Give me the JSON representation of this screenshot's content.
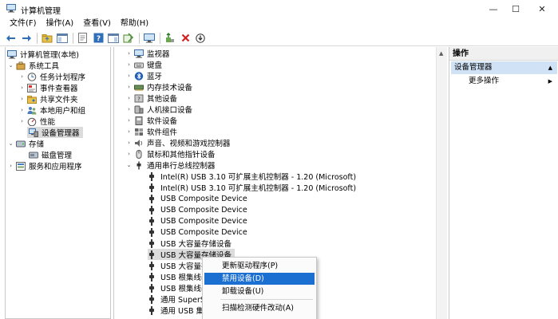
{
  "window": {
    "title": "计算机管理",
    "minimize": "—",
    "maximize": "☐",
    "close": "✕"
  },
  "menu": [
    "文件(F)",
    "操作(A)",
    "查看(V)",
    "帮助(H)"
  ],
  "left_tree": [
    {
      "label": "计算机管理(本地)",
      "expander": "",
      "icon": "computer-icon"
    },
    {
      "label": "系统工具",
      "expander": "⌄",
      "icon": "tools-icon"
    },
    {
      "label": "任务计划程序",
      "expander": "›",
      "icon": "clock-icon"
    },
    {
      "label": "事件查看器",
      "expander": "›",
      "icon": "event-viewer-icon"
    },
    {
      "label": "共享文件夹",
      "expander": "›",
      "icon": "shared-folder-icon"
    },
    {
      "label": "本地用户和组",
      "expander": "›",
      "icon": "users-icon"
    },
    {
      "label": "性能",
      "expander": "›",
      "icon": "performance-icon"
    },
    {
      "label": "设备管理器",
      "expander": "",
      "icon": "device-manager-icon"
    },
    {
      "label": "存储",
      "expander": "⌄",
      "icon": "storage-icon"
    },
    {
      "label": "磁盘管理",
      "expander": "",
      "icon": "disk-icon"
    },
    {
      "label": "服务和应用程序",
      "expander": "›",
      "icon": "services-icon"
    }
  ],
  "device_tree": [
    {
      "label": "监视器",
      "expander": "›",
      "icon": "monitor-icon",
      "child": false
    },
    {
      "label": "键盘",
      "expander": "›",
      "icon": "keyboard-icon",
      "child": false
    },
    {
      "label": "蓝牙",
      "expander": "›",
      "icon": "bluetooth-icon",
      "child": false
    },
    {
      "label": "内存技术设备",
      "expander": "›",
      "icon": "memory-icon",
      "child": false
    },
    {
      "label": "其他设备",
      "expander": "›",
      "icon": "other-devices-icon",
      "child": false
    },
    {
      "label": "人机接口设备",
      "expander": "›",
      "icon": "hid-icon",
      "child": false
    },
    {
      "label": "软件设备",
      "expander": "›",
      "icon": "software-device-icon",
      "child": false
    },
    {
      "label": "软件组件",
      "expander": "›",
      "icon": "software-component-icon",
      "child": false
    },
    {
      "label": "声音、视频和游戏控制器",
      "expander": "›",
      "icon": "sound-icon",
      "child": false
    },
    {
      "label": "鼠标和其他指针设备",
      "expander": "›",
      "icon": "mouse-icon",
      "child": false
    },
    {
      "label": "通用串行总线控制器",
      "expander": "⌄",
      "icon": "usb-icon",
      "child": false
    },
    {
      "label": "Intel(R) USB 3.10 可扩展主机控制器 - 1.20 (Microsoft)",
      "child": true
    },
    {
      "label": "Intel(R) USB 3.10 可扩展主机控制器 - 1.20 (Microsoft)",
      "child": true
    },
    {
      "label": "USB Composite Device",
      "child": true
    },
    {
      "label": "USB Composite Device",
      "child": true
    },
    {
      "label": "USB Composite Device",
      "child": true
    },
    {
      "label": "USB Composite Device",
      "child": true
    },
    {
      "label": "USB 大容量存储设备",
      "child": true
    },
    {
      "label": "USB 大容量存储设备",
      "child": true,
      "selected": true
    },
    {
      "label": "USB 大容量存",
      "child": true
    },
    {
      "label": "USB 根集线器",
      "child": true
    },
    {
      "label": "USB 根集线器",
      "child": true
    },
    {
      "label": "通用 SuperSp",
      "child": true
    },
    {
      "label": "通用 USB 集",
      "child": true
    }
  ],
  "context_menu": [
    {
      "label": "更新驱动程序(P)",
      "highlighted": false
    },
    {
      "label": "禁用设备(D)",
      "highlighted": true
    },
    {
      "label": "卸载设备(U)",
      "highlighted": false
    },
    {
      "label": "扫描检测硬件改动(A)",
      "highlighted": false
    }
  ],
  "actions_pane": {
    "header": "操作",
    "section": "设备管理器",
    "more": "更多操作"
  },
  "colors": {
    "selection": "#1a6fd0",
    "actions_section": "#cfe2f6"
  }
}
